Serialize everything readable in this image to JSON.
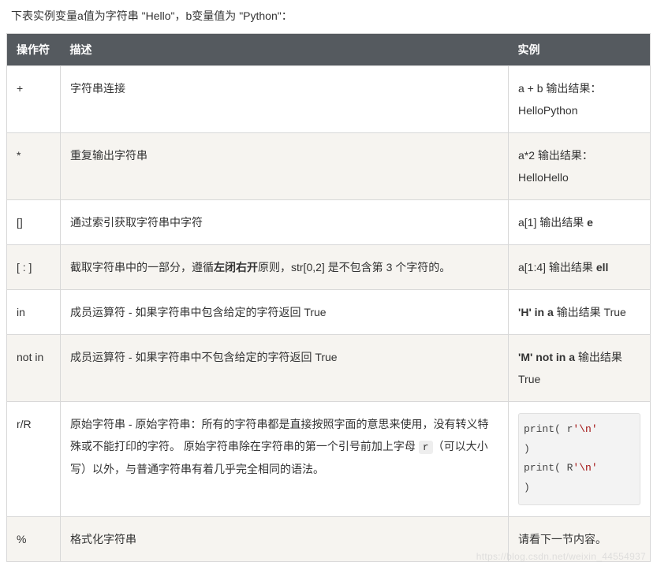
{
  "intro": "下表实例变量a值为字符串 \"Hello\"，b变量值为 \"Python\"：",
  "headers": {
    "op": "操作符",
    "desc": "描述",
    "ex": "实例"
  },
  "rows": [
    {
      "op": "+",
      "desc_plain": "字符串连接",
      "example_plain": "a + b 输出结果： HelloPython"
    },
    {
      "op": "*",
      "desc_plain": "重复输出字符串",
      "example_plain": "a*2 输出结果：HelloHello"
    },
    {
      "op": "[]",
      "desc_plain": "通过索引获取字符串中字符",
      "example_parts": {
        "pre": "a[1] 输出结果 ",
        "bold": "e",
        "post": ""
      }
    },
    {
      "op": "[ : ]",
      "desc_parts": {
        "pre": "截取字符串中的一部分，遵循",
        "bold": "左闭右开",
        "post": "原则，str[0,2] 是不包含第 3 个字符的。"
      },
      "example_parts": {
        "pre": "a[1:4] 输出结果 ",
        "bold": "ell",
        "post": ""
      }
    },
    {
      "op": "in",
      "desc_plain": "成员运算符 - 如果字符串中包含给定的字符返回 True",
      "example_parts": {
        "pre": "",
        "bold": "'H' in a",
        "post": " 输出结果 True"
      }
    },
    {
      "op": "not in",
      "desc_plain": "成员运算符 - 如果字符串中不包含给定的字符返回 True",
      "example_parts": {
        "pre": "",
        "bold": "'M' not in a",
        "post": " 输出结果 True"
      }
    },
    {
      "op": "r/R",
      "desc_raw": {
        "pre": "原始字符串 - 原始字符串：所有的字符串都是直接按照字面的意思来使用，没有转义特殊或不能打印的字符。 原始字符串除在字符串的第一个引号前加上字母 ",
        "code": "r",
        "post": "（可以大小写）以外，与普通字符串有着几乎完全相同的语法。"
      },
      "code": {
        "l1a": "print( r",
        "l1b": "'\\n'",
        "l2": ")",
        "l3a": "print( R",
        "l3b": "'\\n'",
        "l4": ")"
      }
    },
    {
      "op": "%",
      "desc_plain": "格式化字符串",
      "example_plain": "请看下一节内容。"
    }
  ],
  "watermark": "https://blog.csdn.net/weixin_44554937"
}
